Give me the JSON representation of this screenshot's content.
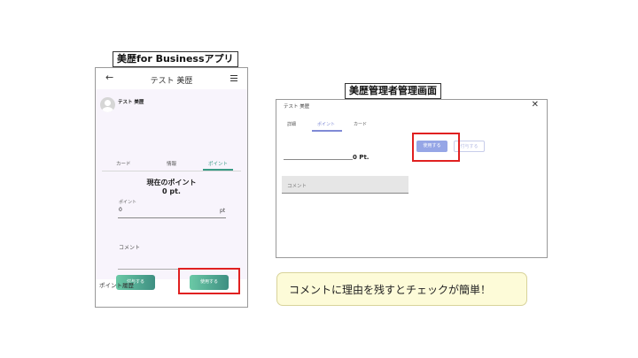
{
  "captions": {
    "left": "美歴for Businessアプリ",
    "right": "美歴管理者管理画面"
  },
  "phone": {
    "title": "テスト 美歴",
    "user_name": "テスト 美歴",
    "tabs": [
      "カード",
      "情報",
      "ポイント"
    ],
    "active_tab": "ポイント",
    "current_point_label": "現在のポイント",
    "current_point_value": "0 pt.",
    "point_field": {
      "label": "ポイント",
      "value": "0",
      "unit": "pt"
    },
    "comment_label": "コメント",
    "grant_button": "付与する",
    "use_button": "使用する",
    "history_label": "ポイント履歴",
    "colors": {
      "accent": "#3a9b86",
      "button_from": "#6bc9a6",
      "button_to": "#3e8f82",
      "body_bg": "#f8f4fc"
    }
  },
  "admin": {
    "title": "テスト 美歴",
    "tabs": [
      "詳細",
      "ポイント",
      "カード"
    ],
    "active_tab": "ポイント",
    "point_value": "0 Pt.",
    "comment_placeholder": "コメント",
    "use_button": "使用する",
    "grant_button": "付与する",
    "colors": {
      "accent": "#7f8ad6",
      "use_button": "#96a6e6"
    }
  },
  "highlight_color": "#e02020",
  "note": "コメントに理由を残すとチェックが簡単！"
}
